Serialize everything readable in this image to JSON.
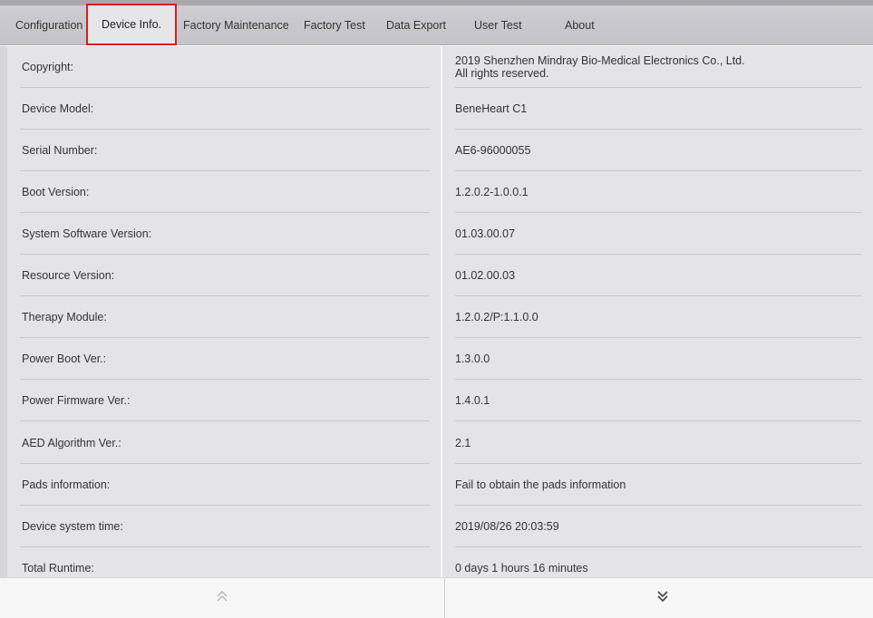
{
  "tabs": [
    {
      "label": "Configuration"
    },
    {
      "label": "Device Info.",
      "active": true
    },
    {
      "label": "Factory Maintenance"
    },
    {
      "label": "Factory Test"
    },
    {
      "label": "Data Export"
    },
    {
      "label": "User Test"
    },
    {
      "label": "About"
    }
  ],
  "rows": [
    {
      "label": "Copyright:",
      "value_line1": "2019 Shenzhen Mindray Bio-Medical Electronics Co., Ltd.",
      "value_line2": "All rights reserved."
    },
    {
      "label": "Device Model:",
      "value": "BeneHeart C1"
    },
    {
      "label": "Serial Number:",
      "value": "AE6-96000055"
    },
    {
      "label": "Boot Version:",
      "value": "1.2.0.2-1.0.0.1"
    },
    {
      "label": "System Software Version:",
      "value": "01.03.00.07"
    },
    {
      "label": "Resource Version:",
      "value": "01.02.00.03"
    },
    {
      "label": "Therapy Module:",
      "value": "1.2.0.2/P:1.1.0.0"
    },
    {
      "label": "Power Boot Ver.:",
      "value": "1.3.0.0"
    },
    {
      "label": "Power Firmware Ver.:",
      "value": "1.4.0.1"
    },
    {
      "label": "AED Algorithm Ver.:",
      "value": "2.1"
    },
    {
      "label": "Pads information:",
      "value": "Fail to obtain the pads information"
    },
    {
      "label": "Device system time:",
      "value": "2019/08/26 20:03:59"
    },
    {
      "label": "Total Runtime:",
      "value": "0 days 1 hours 16 minutes"
    }
  ],
  "footer": {
    "scroll_up_icon": "double-chevron-up-icon",
    "scroll_down_icon": "double-chevron-down-icon"
  },
  "colors": {
    "active_tab_border": "#d91e18",
    "panel_background": "#e4e4e7"
  }
}
